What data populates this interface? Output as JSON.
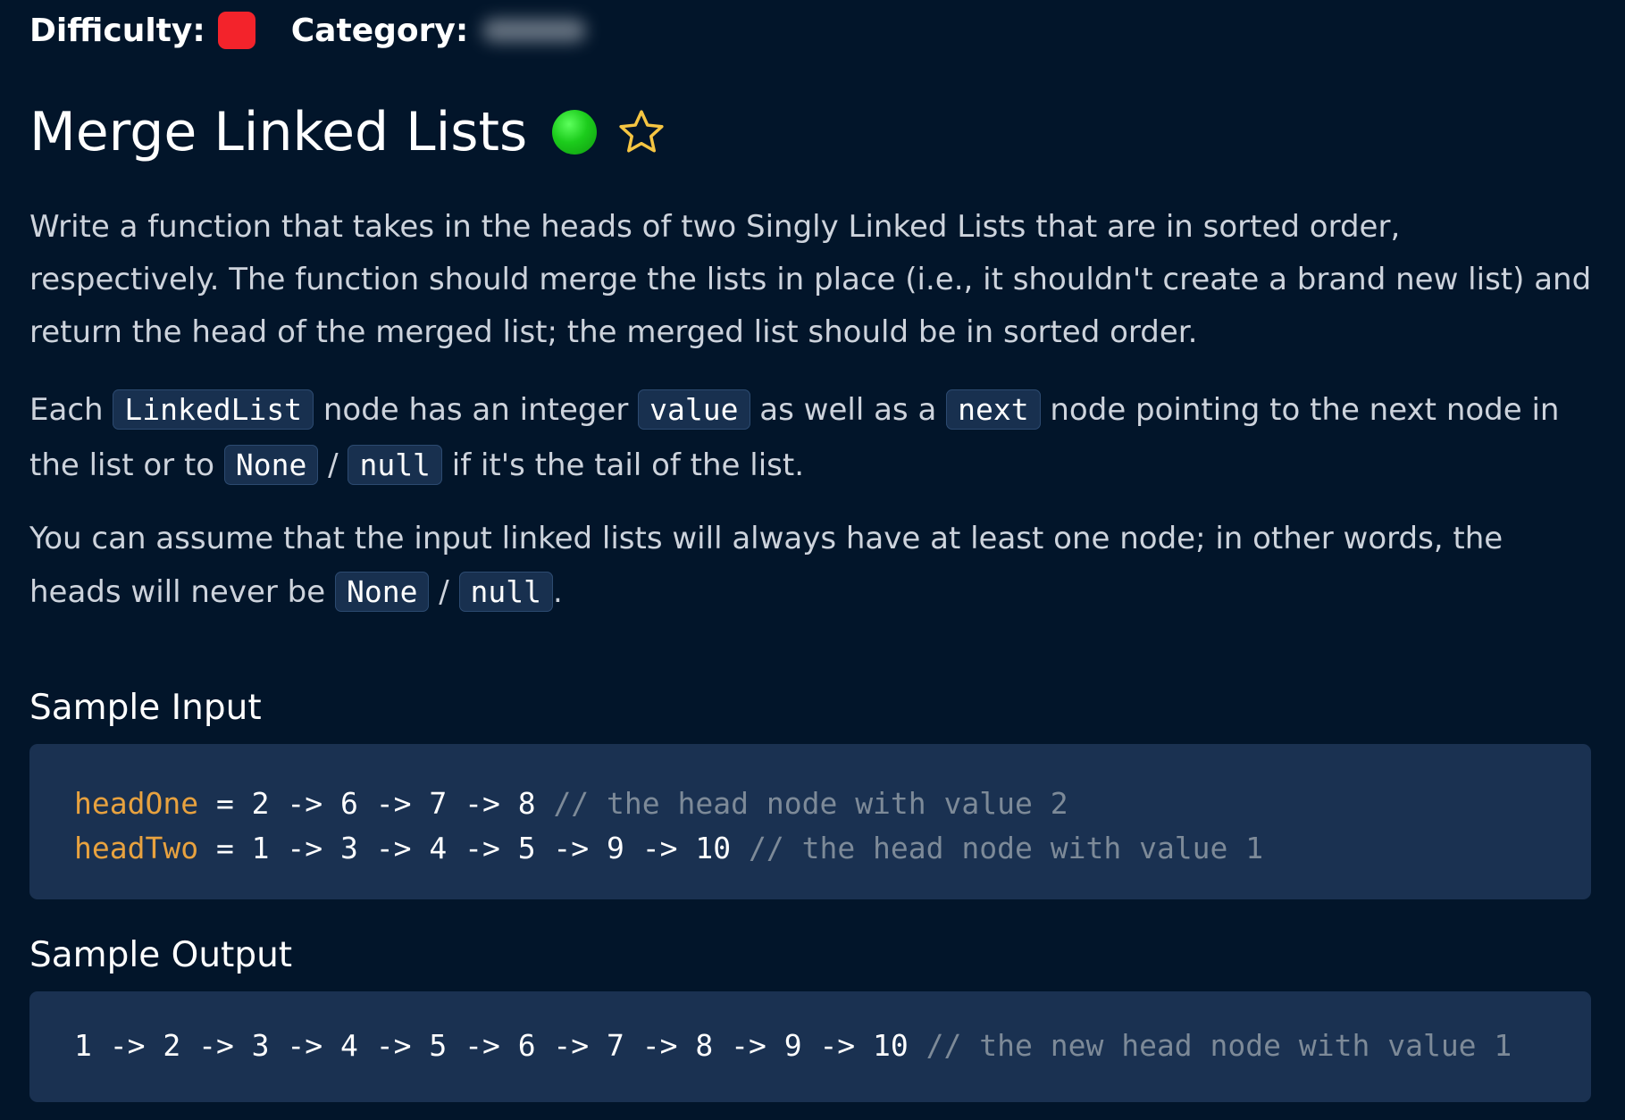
{
  "header": {
    "difficulty_label": "Difficulty:",
    "difficulty_color": "#f3232b",
    "category_label": "Category:"
  },
  "title": {
    "text": "Merge Linked Lists",
    "status_icon": "green-dot-icon",
    "favorite_icon": "star-outline-icon"
  },
  "description": {
    "p1": "Write a function that takes in the heads of two Singly Linked Lists that are in sorted order, respectively. The function should merge the lists in place (i.e., it shouldn't create a brand new list) and return the head of the merged list; the merged list should be in sorted order.",
    "p2": {
      "t1": "Each ",
      "c1": "LinkedList",
      "t2": " node has an integer ",
      "c2": "value",
      "t3": " as well as a ",
      "c3": "next",
      "t4": " node pointing to the next node in the list or to ",
      "c4": "None",
      "t5": " / ",
      "c5": "null",
      "t6": " if it's the tail of the list."
    },
    "p3": {
      "t1": "You can assume that the input linked lists will always have at least one node; in other words, the heads will never be ",
      "c1": "None",
      "t2": " / ",
      "c2": "null",
      "t3": "."
    }
  },
  "sample_input": {
    "heading": "Sample Input",
    "lines": [
      {
        "var": "headOne",
        "code": " = 2 -> 6 -> 7 -> 8 ",
        "comment": "// the head node with value 2"
      },
      {
        "var": "headTwo",
        "code": " = 1 -> 3 -> 4 -> 5 -> 9 -> 10 ",
        "comment": "// the head node with value 1"
      }
    ]
  },
  "sample_output": {
    "heading": "Sample Output",
    "code": "1 -> 2 -> 3 -> 4 -> 5 -> 6 -> 7 -> 8 -> 9 -> 10 ",
    "comment": "// the new head node with value 1"
  },
  "colors": {
    "background": "#02152a",
    "code_background": "#1a3151",
    "variable": "#e8a23f",
    "comment": "#7d8a98",
    "star": "#f5c542",
    "status_green": "#1ccc1c"
  }
}
